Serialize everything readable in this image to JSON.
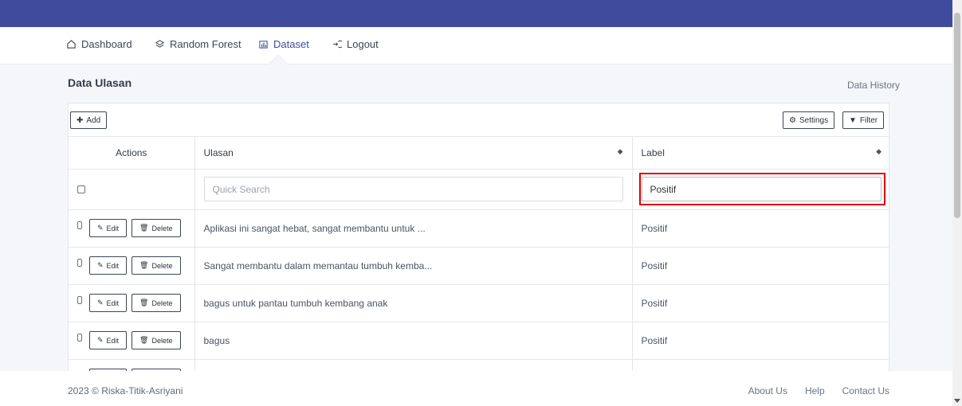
{
  "nav": {
    "items": [
      {
        "label": "Dashboard",
        "icon": "home-icon"
      },
      {
        "label": "Random Forest",
        "icon": "layers-icon"
      },
      {
        "label": "Dataset",
        "icon": "chart-icon"
      },
      {
        "label": "Logout",
        "icon": "logout-icon"
      }
    ],
    "active": "Dataset"
  },
  "page": {
    "title": "Data Ulasan",
    "history_link": "Data History"
  },
  "toolbar": {
    "add_label": "Add",
    "settings_label": "Settings",
    "filter_label": "Filter"
  },
  "table": {
    "headers": {
      "actions": "Actions",
      "ulasan": "Ulasan",
      "label": "Label"
    },
    "filters": {
      "ulasan_placeholder": "Quick Search",
      "label_value": "Positif"
    },
    "edit_label": "Edit",
    "delete_label": "Delete",
    "rows": [
      {
        "ulasan": "Aplikasi ini sangat hebat, sangat membantu untuk ...",
        "label": "Positif"
      },
      {
        "ulasan": "Sangat membantu dalam memantau tumbuh kemba...",
        "label": "Positif"
      },
      {
        "ulasan": "bagus untuk pantau tumbuh kembang anak",
        "label": "Positif"
      },
      {
        "ulasan": "bagus",
        "label": "Positif"
      },
      {
        "ulasan": "",
        "label": ""
      }
    ]
  },
  "footer": {
    "copyright": "2023 © Riska-Titik-Asriyani",
    "links": [
      "About Us",
      "Help",
      "Contact Us"
    ]
  },
  "colors": {
    "topbar": "#3f4c9c",
    "highlight": "#e00000",
    "background": "#f5f6fa"
  }
}
